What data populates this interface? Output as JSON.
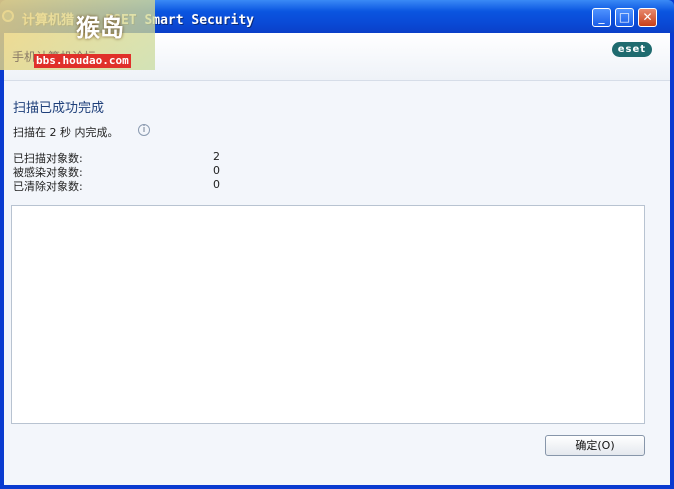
{
  "window": {
    "title": "计算机猎... ESET Smart Security",
    "minimize_icon": "minimize-icon",
    "maximize_icon": "maximize-icon",
    "close_icon": "close-icon"
  },
  "watermark": {
    "logo_text": "猴岛",
    "domain": "bbs.houdao.com",
    "subtitle": "手机计算机论坛"
  },
  "brand": {
    "logo_text": "eset",
    "accent_color": "#1f6b6f"
  },
  "scan": {
    "heading": "扫描已成功完成",
    "summary": "扫描在 2 秒 内完成。",
    "info_icon": "info-icon",
    "stats": [
      {
        "label": "已扫描对象数:",
        "value": "2"
      },
      {
        "label": "被感染对象数:",
        "value": "0"
      },
      {
        "label": "已清除对象数:",
        "value": "0"
      }
    ]
  },
  "actions": {
    "ok_label": "确定(O)"
  }
}
